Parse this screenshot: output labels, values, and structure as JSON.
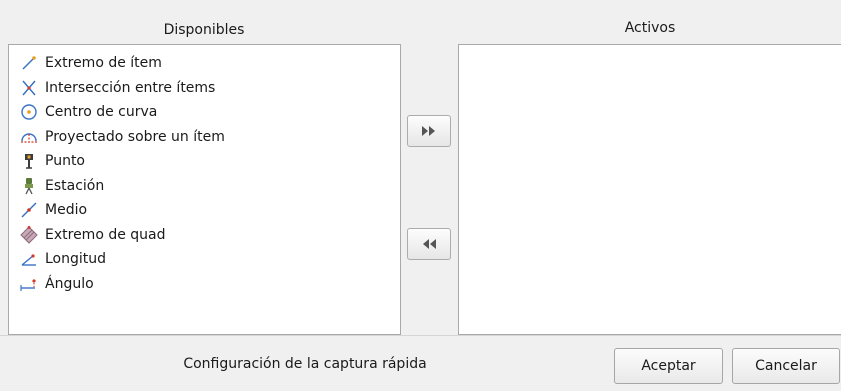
{
  "available": {
    "title": "Disponibles",
    "items": [
      {
        "label": "Extremo de ítem",
        "icon": "endpoint-icon"
      },
      {
        "label": "Intersección entre ítems",
        "icon": "intersection-icon"
      },
      {
        "label": "Centro de curva",
        "icon": "curve-center-icon"
      },
      {
        "label": "Proyectado sobre un ítem",
        "icon": "projected-icon"
      },
      {
        "label": "Punto",
        "icon": "point-icon"
      },
      {
        "label": "Estación",
        "icon": "station-icon"
      },
      {
        "label": "Medio",
        "icon": "midpoint-icon"
      },
      {
        "label": "Extremo de quad",
        "icon": "quad-endpoint-icon"
      },
      {
        "label": "Longitud",
        "icon": "length-icon"
      },
      {
        "label": "Ángulo",
        "icon": "angle-icon"
      }
    ]
  },
  "active": {
    "title": "Activos",
    "items": []
  },
  "controls": {
    "move_right_icon": "double-chevron-right-icon",
    "move_left_icon": "double-chevron-left-icon"
  },
  "footer": {
    "title": "Configuración de la captura rápida",
    "ok_label": "Aceptar",
    "cancel_label": "Cancelar"
  },
  "colors": {
    "icon_blue": "#3a72c4",
    "icon_red": "#d03a2a",
    "icon_orange": "#e8a028"
  }
}
